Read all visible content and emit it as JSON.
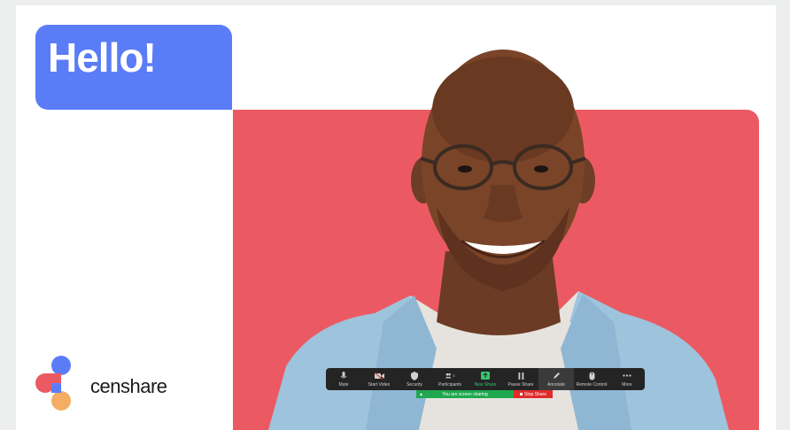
{
  "slide": {
    "greeting": "Hello!",
    "brand": "censhare"
  },
  "colors": {
    "hello_box": "#5b7cf7",
    "panel": "#eb5a62",
    "toolbar": "#242424",
    "sharing_green": "#1fa84f",
    "stop_red": "#e02b2b"
  },
  "toolbar": {
    "items": [
      {
        "label": "Mute",
        "icon": "microphone-icon"
      },
      {
        "label": "Start Video",
        "icon": "video-camera-icon"
      },
      {
        "label": "Security",
        "icon": "shield-icon"
      },
      {
        "label": "Participants",
        "icon": "participants-icon",
        "count": "3"
      },
      {
        "label": "New Share",
        "icon": "share-screen-icon"
      },
      {
        "label": "Pause Share",
        "icon": "pause-icon"
      },
      {
        "label": "Annotate",
        "icon": "pencil-icon"
      },
      {
        "label": "Remote Control",
        "icon": "mouse-icon"
      },
      {
        "label": "More",
        "icon": "more-icon"
      }
    ],
    "sharing_status": "You are screen sharing",
    "stop_share": "Stop Share"
  }
}
